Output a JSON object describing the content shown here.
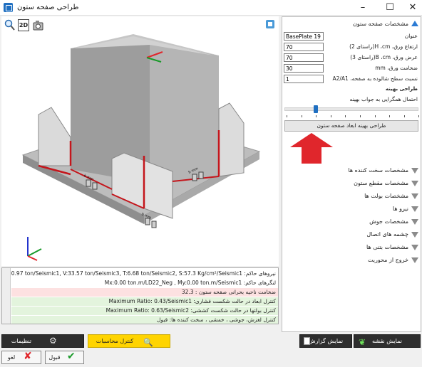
{
  "window": {
    "title": "طراحی صفحه ستون",
    "minimize": "–",
    "maximize": "☐",
    "close": "✕"
  },
  "toolbar": {
    "view2d": "2D"
  },
  "viewport": {
    "labels": [
      "b mm",
      "b mm",
      "b mm"
    ]
  },
  "log": {
    "rows": [
      "نیروهای حاکم: P:280.97 ton/Seismic1, V:33.57 ton/Seismic3, T:6.68 ton/Seismic2, S:57.3 Kg/cm²/Seismic1",
      "لنگرهای حاکم: Mx:0.00 ton.m/LD22_Neg , My:0.00 ton.m/Seismic1",
      "ضخامت ناحیه بحرانی صفحه ستون : 32.3",
      "کنترل ابعاد در حالت شکست فشاری: Maximum Ratio: 0.43/Seismic1",
      "کنترل بولتها در حالت شکست کششی: Maximum Ratio: 0.63/Seismic2",
      "کنترل لغزش، جوشی ، خمشی ، سخت کننده ها: قبول"
    ]
  },
  "panel": {
    "section_plate": "مشخصات صفحه ستون",
    "fields": [
      {
        "label": "عنوان",
        "value": "BasePlate 19"
      },
      {
        "label": "ارتفاع ورق، H ،cm(راستای 2)",
        "value": "70"
      },
      {
        "label": "عرض ورق، B ،cm(راستای 3)",
        "value": "70"
      },
      {
        "label": "ضخامت ورق، mm",
        "value": "30"
      },
      {
        "label": "نسبت سطح شالوده به صفحه، A2/A1",
        "value": "1"
      }
    ],
    "optimal_title": "طراحی بهینه",
    "convergence_label": "احتمال همگرایی به جواب بهینه",
    "slider_value": 0.22,
    "design_button": "طراحی بهینه ابعاد صفحه ستون",
    "sections": [
      "مشخصات سخت کننده ها",
      "مشخصات مقطع ستون",
      "مشخصات بولت ها",
      "نیرو ها",
      "مشخصات جوش",
      "چشمه های اتصال",
      "مشخصات بتنی ها",
      "خروج از محوریت"
    ]
  },
  "buttons": {
    "show_map": "نمایش نقشه",
    "show_report": "نمایش گزارش",
    "check_calc": "کنترل محاسبات",
    "settings": "تنظیمات",
    "ok": "قبول",
    "cancel": "لغو"
  },
  "colors": {
    "accent": "#1f6fc1",
    "arrow": "#e0262c",
    "stiffener_edge": "#c4161c"
  }
}
